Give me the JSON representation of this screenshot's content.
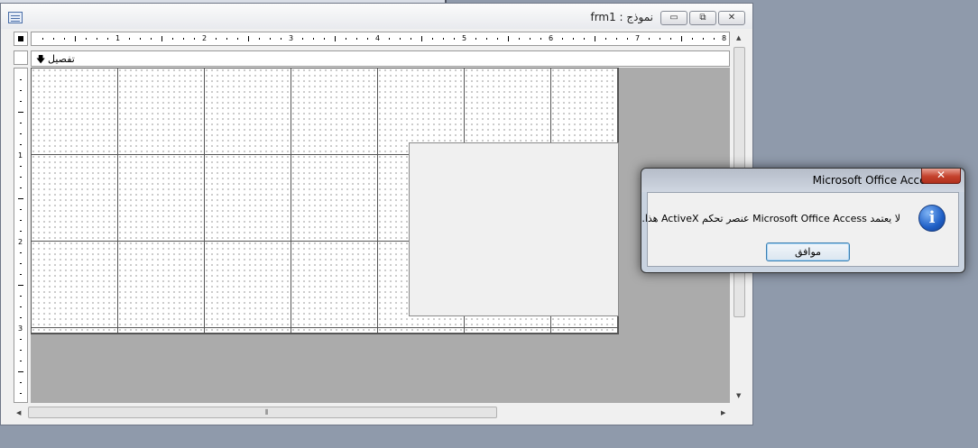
{
  "form_window": {
    "title": "frm1 : نموذج",
    "section_label": "تفصيل",
    "ruler_h_labels": [
      "1",
      "2",
      "3",
      "4",
      "5",
      "6",
      "7",
      "8"
    ],
    "ruler_v_labels": [
      "1",
      "2",
      "3"
    ],
    "minimize_glyph": "▭",
    "restore_glyph": "⧉",
    "close_glyph": "✕"
  },
  "dialog": {
    "title": "Microsoft Office Access",
    "message": "لا يعتمد Microsoft Office Access عنصر تحكم ActiveX هذا.",
    "ok_label": "موافق",
    "close_glyph": "✕",
    "icon": "info-icon"
  }
}
